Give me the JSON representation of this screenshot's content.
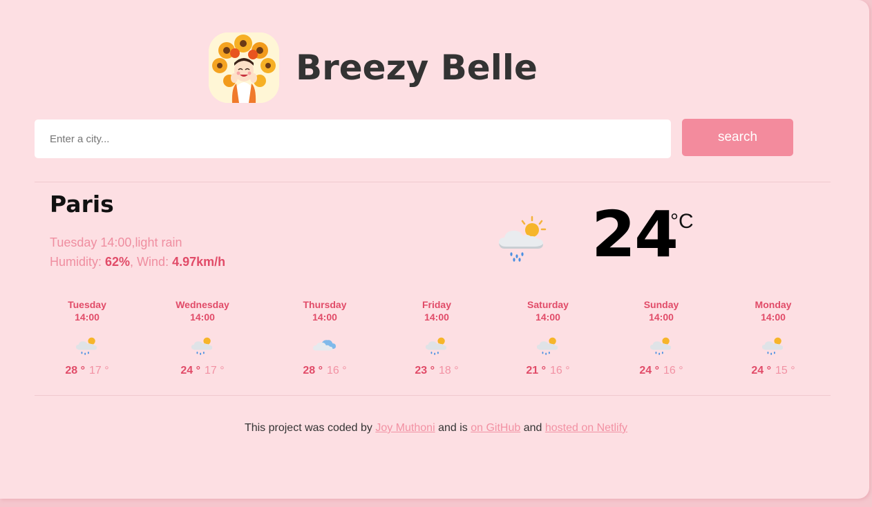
{
  "app": {
    "title": "Breezy Belle"
  },
  "search": {
    "placeholder": "Enter a city...",
    "button_label": "search"
  },
  "current": {
    "city": "Paris",
    "day_time": "Tuesday 14:00",
    "condition": "light rain",
    "humidity_label": "Humidity: ",
    "humidity_value": "62%",
    "wind_label": "Wind: ",
    "wind_value": "4.97km/h",
    "temperature": "24",
    "unit": "°C",
    "icon": "rain-partly-sunny-icon"
  },
  "forecast": [
    {
      "day": "Tuesday",
      "time": "14:00",
      "max": "28 °",
      "min": "17 °",
      "icon": "rain-partly-sunny-icon"
    },
    {
      "day": "Wednesday",
      "time": "14:00",
      "max": "24 °",
      "min": "17 °",
      "icon": "rain-partly-sunny-icon"
    },
    {
      "day": "Thursday",
      "time": "14:00",
      "max": "28 °",
      "min": "16 °",
      "icon": "cloudy-icon"
    },
    {
      "day": "Friday",
      "time": "14:00",
      "max": "23 °",
      "min": "18 °",
      "icon": "rain-partly-sunny-icon"
    },
    {
      "day": "Saturday",
      "time": "14:00",
      "max": "21 °",
      "min": "16 °",
      "icon": "rain-partly-sunny-icon"
    },
    {
      "day": "Sunday",
      "time": "14:00",
      "max": "24 °",
      "min": "16 °",
      "icon": "rain-partly-sunny-icon"
    },
    {
      "day": "Monday",
      "time": "14:00",
      "max": "24 °",
      "min": "15 °",
      "icon": "rain-partly-sunny-icon"
    }
  ],
  "footer": {
    "text_1": "This project was coded by ",
    "link_author": "Joy Muthoni",
    "text_2": " and is ",
    "link_github": "on GitHub",
    "text_3": " and ",
    "link_netlify": "hosted on Netlify"
  },
  "colors": {
    "background": "#fddfe3",
    "accent": "#f38b9d",
    "accent_dark": "#e14b68",
    "accent_light": "#f291a3"
  }
}
